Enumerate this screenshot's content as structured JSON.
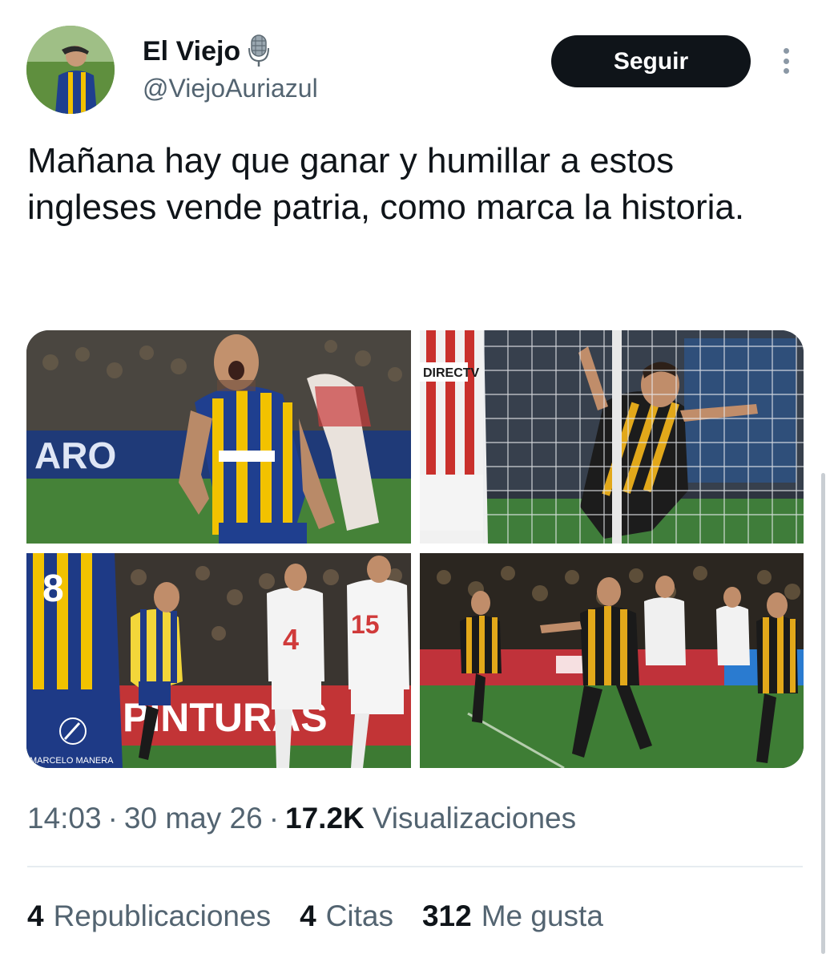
{
  "author": {
    "display_name": "El Viejo",
    "handle": "@ViejoAuriazul",
    "name_emoji_icon": "microphone-icon"
  },
  "follow_button": {
    "label": "Seguir"
  },
  "more_options": {
    "icon": "more-vertical-icon"
  },
  "tweet": {
    "text": "Mañana hay que ganar y humillar a estos ingleses vende patria, como marca la historia."
  },
  "media": {
    "count": 4,
    "photo_3_credit": "MARCELO MANERA",
    "photo_3_banner_text": "PINTURAS",
    "photo_1_banner_text": "ARO"
  },
  "meta": {
    "time": "14:03",
    "separator": "·",
    "date": "30 may 26",
    "views_count": "17.2K",
    "views_label": "Visualizaciones"
  },
  "stats": {
    "reposts_count": "4",
    "reposts_label": "Republicaciones",
    "quotes_count": "4",
    "quotes_label": "Citas",
    "likes_count": "312",
    "likes_label": "Me gusta"
  },
  "colors": {
    "primary_text": "#0f1419",
    "secondary_text": "#536471",
    "button_bg": "#0f1419",
    "divider": "#e6ecf0",
    "jersey_blue": "#1f3f8f",
    "jersey_yellow": "#f2c200"
  }
}
